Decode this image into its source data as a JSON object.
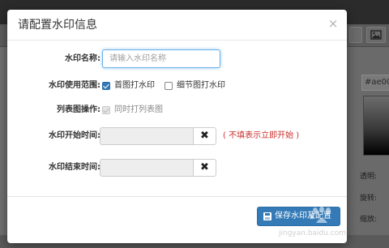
{
  "background": {
    "color_value": "#ae00",
    "props": [
      "透明:",
      "旋转:",
      "缩放:"
    ]
  },
  "modal": {
    "title": "请配置水印信息",
    "close_symbol": "×",
    "name_row": {
      "label": "水印名称:",
      "placeholder": "请输入水印名称",
      "value": ""
    },
    "scope_row": {
      "label": "水印使用范围:",
      "option_first": {
        "label": "首图打水印",
        "checked": true
      },
      "option_detail": {
        "label": "细节图打水印",
        "checked": false
      }
    },
    "list_row": {
      "label": "列表图操作:",
      "option": {
        "label": "同时打列表图",
        "checked": true,
        "disabled": true
      }
    },
    "start_row": {
      "label": "水印开始时间:",
      "value": "",
      "clear_symbol": "✖",
      "hint": "( 不填表示立即开始 )"
    },
    "end_row": {
      "label": "水印结束时间:",
      "value": "",
      "clear_symbol": "✖"
    },
    "footer": {
      "save_label": "保存水印及配置"
    }
  },
  "watermark": {
    "text": "jingyan.baidu.com"
  },
  "colors": {
    "primary": "#337ab7",
    "hint": "#c9302c",
    "input_focus": "#66afe9"
  },
  "icons": [
    "close-icon",
    "checkbox-checked-icon",
    "checkbox-empty-icon",
    "times-icon",
    "floppy-disk-icon",
    "image-icon"
  ]
}
